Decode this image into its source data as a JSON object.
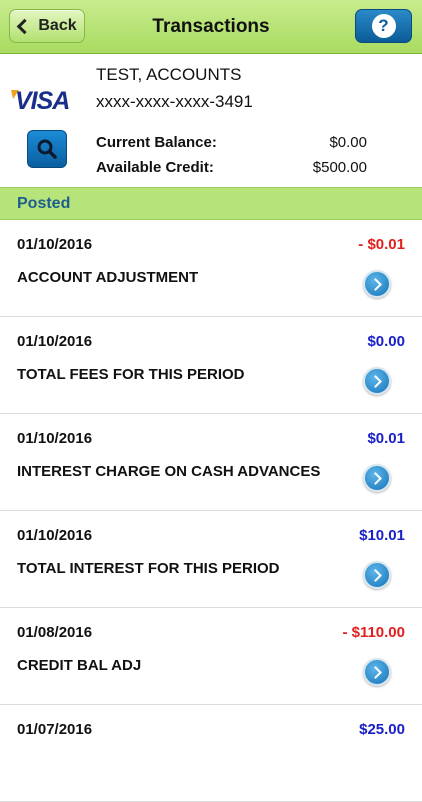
{
  "nav": {
    "back_label": "Back",
    "title": "Transactions",
    "help_label": "?"
  },
  "account": {
    "card_brand": "VISA",
    "name": "TEST, ACCOUNTS",
    "number": "xxxx-xxxx-xxxx-3491",
    "current_balance_label": "Current Balance:",
    "current_balance": "$0.00",
    "available_credit_label": "Available Credit:",
    "available_credit": "$500.00"
  },
  "section": {
    "title": "Posted"
  },
  "colors": {
    "nav_green": "#a9db60",
    "section_green": "#b6e37a",
    "negative": "#e0201f",
    "positive": "#1a20c9",
    "accent_blue": "#0b5c98"
  },
  "transactions": [
    {
      "date": "01/10/2016",
      "amount": "- $0.01",
      "description": "ACCOUNT ADJUSTMENT",
      "type": "negative"
    },
    {
      "date": "01/10/2016",
      "amount": "$0.00",
      "description": "TOTAL FEES FOR THIS PERIOD",
      "type": "positive"
    },
    {
      "date": "01/10/2016",
      "amount": "$0.01",
      "description": "INTEREST CHARGE ON CASH ADVANCES",
      "type": "positive"
    },
    {
      "date": "01/10/2016",
      "amount": "$10.01",
      "description": "TOTAL INTEREST FOR THIS PERIOD",
      "type": "positive"
    },
    {
      "date": "01/08/2016",
      "amount": "- $110.00",
      "description": "CREDIT BAL ADJ",
      "type": "negative"
    },
    {
      "date": "01/07/2016",
      "amount": "$25.00",
      "description": "",
      "type": "positive"
    }
  ]
}
